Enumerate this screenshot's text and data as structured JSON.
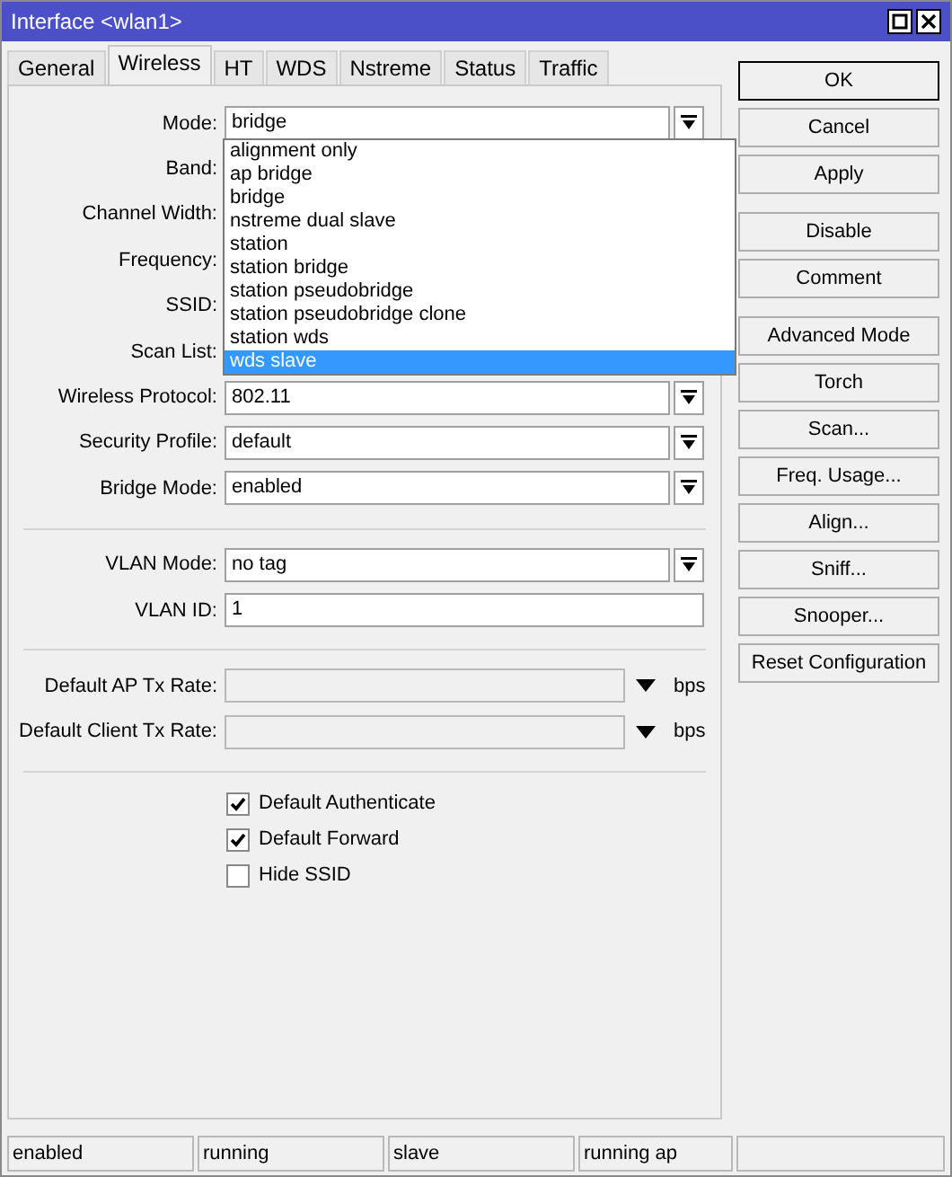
{
  "window": {
    "title": "Interface <wlan1>"
  },
  "tabs": [
    {
      "label": "General",
      "selected": false
    },
    {
      "label": "Wireless",
      "selected": true
    },
    {
      "label": "HT",
      "selected": false
    },
    {
      "label": "WDS",
      "selected": false
    },
    {
      "label": "Nstreme",
      "selected": false
    },
    {
      "label": "Status",
      "selected": false
    },
    {
      "label": "Traffic",
      "selected": false
    }
  ],
  "form": [
    {
      "kind": "select",
      "label": "Mode:",
      "value": "bridge"
    },
    {
      "kind": "covered",
      "label": "Band:"
    },
    {
      "kind": "covered",
      "label": "Channel Width:"
    },
    {
      "kind": "covered",
      "label": "Frequency:"
    },
    {
      "kind": "covered",
      "label": "SSID:"
    },
    {
      "kind": "covered",
      "label": "Scan List:"
    },
    {
      "kind": "select",
      "label": "Wireless Protocol:",
      "value": "802.11"
    },
    {
      "kind": "select",
      "label": "Security Profile:",
      "value": "default"
    },
    {
      "kind": "select",
      "label": "Bridge Mode:",
      "value": "enabled"
    },
    {
      "kind": "separator"
    },
    {
      "kind": "select",
      "label": "VLAN Mode:",
      "value": "no tag"
    },
    {
      "kind": "text",
      "label": "VLAN ID:",
      "value": "1"
    },
    {
      "kind": "separator"
    },
    {
      "kind": "rate",
      "label": "Default AP Tx Rate:",
      "unit": "bps"
    },
    {
      "kind": "rate",
      "label": "Default Client Tx Rate:",
      "unit": "bps"
    },
    {
      "kind": "separator"
    },
    {
      "kind": "checkbox",
      "label": "Default Authenticate",
      "checked": true
    },
    {
      "kind": "checkbox",
      "label": "Default Forward",
      "checked": true
    },
    {
      "kind": "checkbox",
      "label": "Hide SSID",
      "checked": false
    }
  ],
  "mode_dropdown": [
    {
      "label": "alignment only",
      "selected": false
    },
    {
      "label": "ap bridge",
      "selected": false
    },
    {
      "label": "bridge",
      "selected": false
    },
    {
      "label": "nstreme dual slave",
      "selected": false
    },
    {
      "label": "station",
      "selected": false
    },
    {
      "label": "station bridge",
      "selected": false
    },
    {
      "label": "station pseudobridge",
      "selected": false
    },
    {
      "label": "station pseudobridge clone",
      "selected": false
    },
    {
      "label": "station wds",
      "selected": false
    },
    {
      "label": "wds slave",
      "selected": true
    }
  ],
  "button_groups": [
    [
      {
        "label": "OK",
        "default": true
      },
      {
        "label": "Cancel",
        "default": false
      },
      {
        "label": "Apply",
        "default": false
      }
    ],
    [
      {
        "label": "Disable",
        "default": false
      },
      {
        "label": "Comment",
        "default": false
      }
    ],
    [
      {
        "label": "Advanced Mode",
        "default": false
      },
      {
        "label": "Torch",
        "default": false
      },
      {
        "label": "Scan...",
        "default": false
      },
      {
        "label": "Freq. Usage...",
        "default": false
      },
      {
        "label": "Align...",
        "default": false
      },
      {
        "label": "Sniff...",
        "default": false
      },
      {
        "label": "Snooper...",
        "default": false
      },
      {
        "label": "Reset Configuration",
        "default": false
      }
    ]
  ],
  "status_bar": [
    "enabled",
    "running",
    "slave",
    "running ap"
  ]
}
